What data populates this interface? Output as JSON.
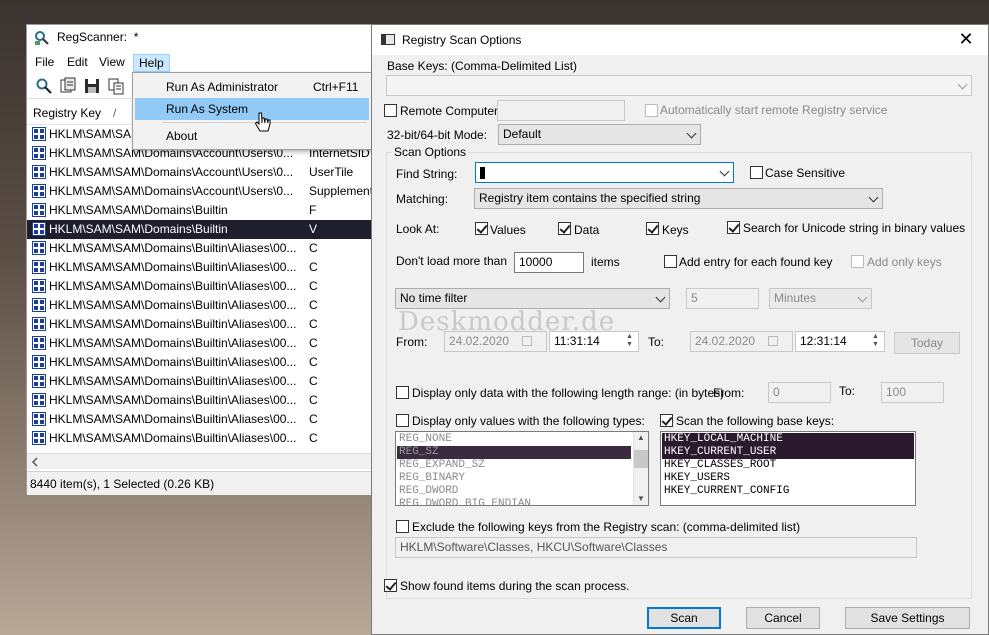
{
  "colors": {
    "selection_dark": "#1e1e2e",
    "menu_hover": "#91c9f7",
    "default_button_border": "#0078d7",
    "dialog_bg": "#f0f0f0"
  },
  "regscanner": {
    "title": "RegScanner:  *",
    "menu": [
      "File",
      "Edit",
      "View",
      "Help"
    ],
    "toolbar_icons": [
      "scan-icon",
      "export-icon",
      "save-icon",
      "copy-icon"
    ],
    "column_header": "Registry Key",
    "sort_indicator": "/",
    "rows": [
      {
        "key": "HKLM\\SAM\\SAM",
        "value": "",
        "selected": false
      },
      {
        "key": "HKLM\\SAM\\SAM\\Domains\\Account\\Users\\0...",
        "value": "InternetSID",
        "selected": false
      },
      {
        "key": "HKLM\\SAM\\SAM\\Domains\\Account\\Users\\0...",
        "value": "UserTile",
        "selected": false
      },
      {
        "key": "HKLM\\SAM\\SAM\\Domains\\Account\\Users\\0...",
        "value": "Supplement",
        "selected": false
      },
      {
        "key": "HKLM\\SAM\\SAM\\Domains\\Builtin",
        "value": "F",
        "selected": false
      },
      {
        "key": "HKLM\\SAM\\SAM\\Domains\\Builtin",
        "value": "V",
        "selected": true
      },
      {
        "key": "HKLM\\SAM\\SAM\\Domains\\Builtin\\Aliases\\00...",
        "value": "C",
        "selected": false
      },
      {
        "key": "HKLM\\SAM\\SAM\\Domains\\Builtin\\Aliases\\00...",
        "value": "C",
        "selected": false
      },
      {
        "key": "HKLM\\SAM\\SAM\\Domains\\Builtin\\Aliases\\00...",
        "value": "C",
        "selected": false
      },
      {
        "key": "HKLM\\SAM\\SAM\\Domains\\Builtin\\Aliases\\00...",
        "value": "C",
        "selected": false
      },
      {
        "key": "HKLM\\SAM\\SAM\\Domains\\Builtin\\Aliases\\00...",
        "value": "C",
        "selected": false
      },
      {
        "key": "HKLM\\SAM\\SAM\\Domains\\Builtin\\Aliases\\00...",
        "value": "C",
        "selected": false
      },
      {
        "key": "HKLM\\SAM\\SAM\\Domains\\Builtin\\Aliases\\00...",
        "value": "C",
        "selected": false
      },
      {
        "key": "HKLM\\SAM\\SAM\\Domains\\Builtin\\Aliases\\00...",
        "value": "C",
        "selected": false
      },
      {
        "key": "HKLM\\SAM\\SAM\\Domains\\Builtin\\Aliases\\00...",
        "value": "C",
        "selected": false
      },
      {
        "key": "HKLM\\SAM\\SAM\\Domains\\Builtin\\Aliases\\00...",
        "value": "C",
        "selected": false
      },
      {
        "key": "HKLM\\SAM\\SAM\\Domains\\Builtin\\Aliases\\00...",
        "value": "C",
        "selected": false
      }
    ],
    "status": "8440 item(s), 1 Selected  (0.26 KB)",
    "help_menu": {
      "items": [
        {
          "label": "Run As Administrator",
          "shortcut": "Ctrl+F11"
        },
        {
          "label": "Run As System",
          "shortcut": ""
        },
        {
          "label": "About",
          "shortcut": ""
        }
      ]
    }
  },
  "dialog": {
    "title": "Registry Scan Options",
    "close_glyph": "✕",
    "base_keys_label": "Base Keys:  (Comma-Delimited List)",
    "base_keys_value": "",
    "remote_computer_label": "Remote Computer:",
    "remote_computer_value": "",
    "auto_start_label": "Automatically start remote Registry service",
    "mode_label": "32-bit/64-bit Mode:",
    "mode_value": "Default",
    "scan_options_label": "Scan Options",
    "find_string_label": "Find String:",
    "find_string_value": "",
    "case_sensitive_label": "Case Sensitive",
    "matching_label": "Matching:",
    "matching_value": "Registry item contains the specified string",
    "look_at_label": "Look At:",
    "values_label": "Values",
    "data_label": "Data",
    "keys_label": "Keys",
    "unicode_label": "Search for Unicode string in binary values",
    "dont_load_label": "Don't load more than",
    "dont_load_value": "10000",
    "items_label": "items",
    "add_entry_label": "Add entry for each found key",
    "add_only_keys_label": "Add only keys",
    "time_filter_value": "No time filter",
    "time_amount_value": "5",
    "time_unit_value": "Minutes",
    "watermark": "Deskmodder.de",
    "from_label": "From:",
    "from_date": "24.02.2020",
    "from_time": "11:31:14",
    "to_label": "To:",
    "to_date": "24.02.2020",
    "to_time": "12:31:14",
    "today_label": "Today",
    "length_range_label": "Display only data with the following length range: (in bytes)",
    "length_from_label": "From:",
    "length_from_value": "0",
    "length_to_label": "To:",
    "length_to_value": "100",
    "types_label": "Display only values with the following types:",
    "types": [
      "REG_NONE",
      "REG_SZ",
      "REG_EXPAND_SZ",
      "REG_BINARY",
      "REG_DWORD",
      "REG_DWORD_BIG_ENDIAN"
    ],
    "types_selected_index": 1,
    "base_scan_label": "Scan the following base keys:",
    "base_scan_keys": [
      "HKEY_LOCAL_MACHINE",
      "HKEY_CURRENT_USER",
      "HKEY_CLASSES_ROOT",
      "HKEY_USERS",
      "HKEY_CURRENT_CONFIG"
    ],
    "base_scan_selected": [
      0,
      1
    ],
    "exclude_label": "Exclude the following keys from the Registry scan: (comma-delimited list)",
    "exclude_value": "HKLM\\Software\\Classes, HKCU\\Software\\Classes",
    "show_found_label": "Show found items during the scan process.",
    "scan_button": "Scan",
    "cancel_button": "Cancel",
    "save_settings_button": "Save Settings"
  }
}
